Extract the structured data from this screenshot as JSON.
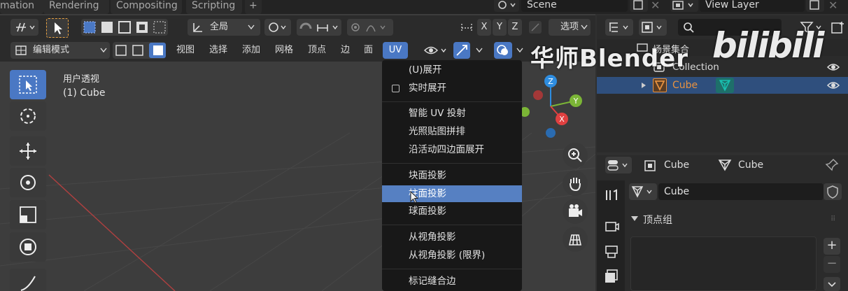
{
  "workspace_tabs": [
    "mation",
    "Rendering",
    "Compositing",
    "Scripting"
  ],
  "add_tab_label": "+",
  "scene": {
    "label": "Scene"
  },
  "view_layer": {
    "label": "View Layer"
  },
  "viewport": {
    "transform_orientation": "全局",
    "axes": [
      "X",
      "Y",
      "Z"
    ],
    "options_label": "选项",
    "mode_label": "编辑模式",
    "menus": [
      "视图",
      "选择",
      "添加",
      "网格",
      "顶点",
      "边",
      "面",
      "UV"
    ],
    "overlay_title": "用户透视",
    "overlay_object": "(1) Cube"
  },
  "uv_menu": {
    "items": [
      {
        "label": "(U)展开"
      },
      {
        "label": "实时展开",
        "checkbox": true
      },
      {
        "label": "智能 UV 投射"
      },
      {
        "label": "光照贴图拼排"
      },
      {
        "label": "沿活动四边面展开"
      },
      {
        "label": "块面投影"
      },
      {
        "label": "柱面投影",
        "highlighted": true
      },
      {
        "label": "球面投影"
      },
      {
        "label": "从视角投影"
      },
      {
        "label": "从视角投影 (限界)"
      },
      {
        "label": "标记缝合边"
      }
    ]
  },
  "gizmo": {
    "z": "Z",
    "y": "Y",
    "x": "X"
  },
  "outliner": {
    "header_label": "场景集合",
    "collection_label": "Collection",
    "object_label": "Cube"
  },
  "properties": {
    "breadcrumb_object": "Cube",
    "breadcrumb_mesh": "Cube",
    "mesh_name": "Cube",
    "section_title": "顶点组"
  },
  "watermark": {
    "text": "华师Blender",
    "logo": "bilibili"
  },
  "colors": {
    "accent": "#4a78c4",
    "highlight": "#5680c2",
    "axis_x": "#e04040",
    "axis_y": "#7bb536",
    "axis_z": "#2e8de0",
    "object_orange": "#e89240",
    "mesh_teal": "#18c0b0"
  }
}
